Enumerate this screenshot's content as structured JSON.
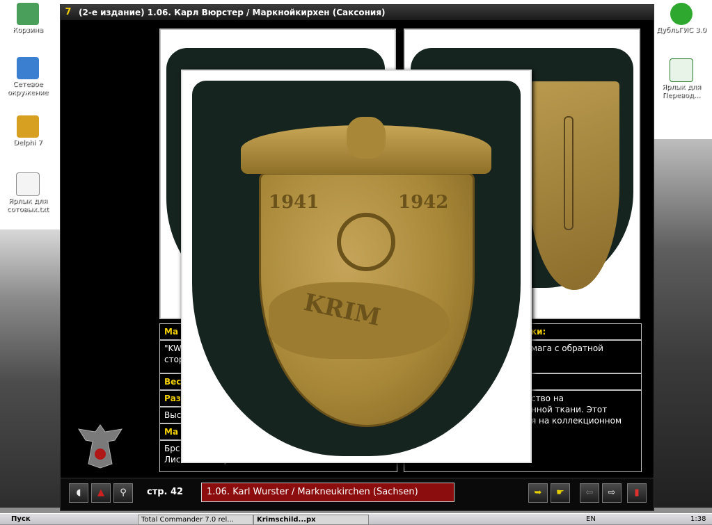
{
  "desktop": {
    "icons_left": [
      {
        "label": "Корзина",
        "icon": "recycle-bin-icon"
      },
      {
        "label": "Сетевое окружение",
        "icon": "network-icon"
      },
      {
        "label": "Delphi 7",
        "icon": "delphi-icon"
      },
      {
        "label": "Ярлык для сотовых.txt",
        "icon": "text-file-shortcut-icon"
      }
    ],
    "icons_right": [
      {
        "label": "ДубльГИС 3.0",
        "icon": "dublgis-icon"
      },
      {
        "label": "Ярлык для Перевод...",
        "icon": "excel-shortcut-icon"
      }
    ]
  },
  "window": {
    "title": "(2-е издание) 1.06.  Карл Вюрстер / Маркнойкирхен (Саксония)"
  },
  "info_left": {
    "row1_head": "Ма",
    "row1_text": "\"KW",
    "row1_text2": "стор",
    "row2_head": "Вес",
    "row3_head": "Раз",
    "row3_text": "Выс",
    "row4_head": "Ма",
    "row4_text": "Брс",
    "row4_text2": "Листовая латунь"
  },
  "info_right": {
    "row1_head": "ки:",
    "row1_text": "мага с обратной",
    "row3_text": "ство на",
    "row3_text2": "нной  ткани. Этот",
    "row3_text3": "я на коллекционном"
  },
  "zoom": {
    "year_left": "1941",
    "year_right": "1942",
    "map_text": "KRIM"
  },
  "toolbar": {
    "page_label": "стр. 42",
    "caption": "1.06. Karl Wurster / Markneukirchen (Sachsen)",
    "buttons": [
      {
        "icon": "sound-icon"
      },
      {
        "icon": "map-icon"
      },
      {
        "icon": "magnifier-icon"
      },
      {
        "icon": "export-icon"
      },
      {
        "icon": "hand-pointer-icon"
      },
      {
        "icon": "back-arrow-icon"
      },
      {
        "icon": "forward-arrow-icon"
      },
      {
        "icon": "exit-door-icon"
      }
    ]
  },
  "taskbar": {
    "start": "Пуск",
    "tasks": [
      "Total Commander 7.0 rel...",
      "Krimschild...px"
    ],
    "lang": "EN",
    "clock": "1:38"
  },
  "colors": {
    "caption_bg": "#8c0d0d",
    "heading_yellow": "#f3d100",
    "badge_gold": "#a88838",
    "cloth": "#16241f"
  }
}
